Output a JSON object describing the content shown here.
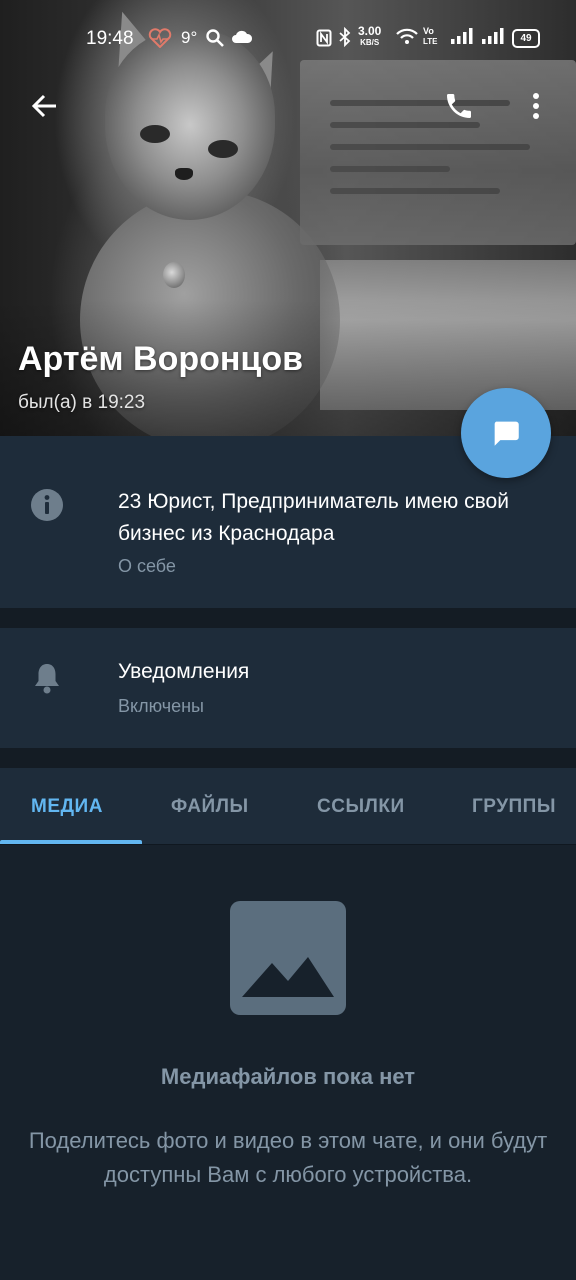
{
  "status_bar": {
    "time": "19:48",
    "temperature": "9°",
    "net_speed_value": "3.00",
    "net_speed_unit": "KB/S",
    "lte_top": "Vo",
    "lte_bottom": "LTE",
    "battery": "49"
  },
  "profile": {
    "name": "Артём Воронцов",
    "last_seen": "был(а) в 19:23"
  },
  "about": {
    "text": "23 Юрист, Предприниматель имею свой бизнес из Краснодара",
    "label": "О себе"
  },
  "notifications": {
    "title": "Уведомления",
    "value": "Включены"
  },
  "tabs": [
    {
      "label": "МЕДИА",
      "active": true
    },
    {
      "label": "ФАЙЛЫ",
      "active": false
    },
    {
      "label": "ССЫЛКИ",
      "active": false
    },
    {
      "label": "ГРУППЫ",
      "active": false
    }
  ],
  "empty_state": {
    "title": "Медиафайлов пока нет",
    "description": "Поделитесь фото и видео в этом чате, и они будут доступны Вам с любого устройства."
  },
  "colors": {
    "background": "#17212b",
    "section": "#1e2c3a",
    "accent": "#62b6f0",
    "fab": "#5aa4de",
    "secondary_text": "#8496a6"
  }
}
